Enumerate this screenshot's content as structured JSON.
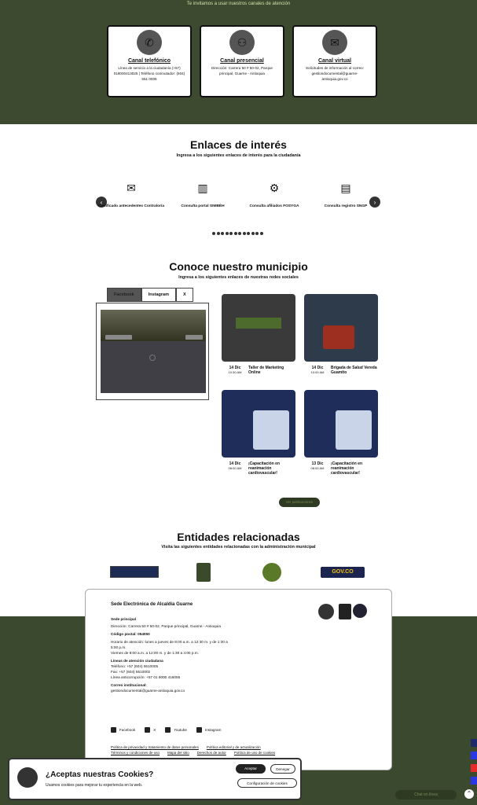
{
  "channels": {
    "intro": "Te invitamos a usar nuestros canales de atención",
    "cards": [
      {
        "icon": "phone-icon",
        "title": "Canal telefónico",
        "desc": "Línea de servicio a la ciudadanía (+57) 018000413025 | Teléfono conmutador: (604) 551 0005"
      },
      {
        "icon": "people-icon",
        "title": "Canal presencial",
        "desc": "Dirección: Carrera 50 # 50-02, Parque principal, Guarne - Antioquia"
      },
      {
        "icon": "mail-icon",
        "title": "Canal virtual",
        "desc": "Solicitudes de información al correo: gestiondocumental@guarne-antioquia.gov.co"
      }
    ]
  },
  "links": {
    "title": "Enlaces de interés",
    "subtitle": "Ingresa a los siguientes enlaces de interés para la ciudadanía",
    "items": [
      {
        "icon": "envelope-icon",
        "glyph": "✉",
        "label": "Certificado antecedentes Contraloría"
      },
      {
        "icon": "card-icon",
        "glyph": "▥",
        "label": "Consulta portal SIMBÉH"
      },
      {
        "icon": "gear-icon",
        "glyph": "⚙",
        "label": "Consulta afiliados FOSYGA"
      },
      {
        "icon": "table-icon",
        "glyph": "▤",
        "label": "Consulta registro SNGP"
      }
    ],
    "prev": "‹",
    "next": "›"
  },
  "municipio": {
    "title": "Conoce nuestro municipio",
    "subtitle": "Ingresa a los siguientes enlaces de nuestras redes sociales",
    "tabs": [
      "Facebook",
      "Instagram",
      "X"
    ],
    "posts": [
      {
        "day": "14 Dic",
        "time": "10:30 AM",
        "title": "Taller de Marketing Online"
      },
      {
        "day": "14 Dic",
        "time": "10:00 AM",
        "title": "Brigada de Salud Vereda Guamito"
      },
      {
        "day": "14 Dic",
        "time": "08:00 AM",
        "title": "¡Capacitación en reanimación cardiovascular!"
      },
      {
        "day": "13 Dic",
        "time": "08:00 AM",
        "title": "¡Capacitación en reanimación cardiovascular!"
      }
    ],
    "more": "Ver publicaciones"
  },
  "entities": {
    "title": "Entidades relacionadas",
    "subtitle": "Visita las siguientes entidades relacionadas con la administración municipal",
    "gov_label": "GOV.CO"
  },
  "footer": {
    "title": "Sede Electrónica de Alcaldía Guarne",
    "sede_label": "Sede principal",
    "address": "Dirección: Carrera 50 # 50-02, Parque principal, Guarne - Antioquia",
    "postal": "Código postal: 054050",
    "hours_label": "Horario de atención: lunes a jueves de 8:00 a.m. a 12:30 m. y de 1:30 a 5:00 p.m.",
    "hours_friday": "Viernes de 8:00 a.m. a 12:00 m. y de 1:30 a 4:00 p.m.",
    "lines_label": "Líneas de atención ciudadana",
    "phone": "Teléfono: +57 (604) 5510005",
    "fax": "Fax: +57 (604) 5510002",
    "anticorr": "Línea anticorrupción: +57 01 8000 416055",
    "email_label": "Correo institucional:",
    "email": "gestiondocumental@guarne-antioquia.gov.co",
    "social": [
      "Facebook",
      "X",
      "Youtube",
      "Instagram"
    ],
    "policy1": "Política de privacidad y tratamiento de datos personales",
    "policy2": "Política editorial y de actualización",
    "policy3": "Términos y condiciones de uso",
    "policy4": "Mapa del sitio",
    "policy5": "Derechos de autor",
    "policy6": "Política de uso de cookies"
  },
  "cookie": {
    "title": "¿Aceptas nuestras Cookies?",
    "text": "Usamos cookies para mejorar tu experiencia en la web.",
    "accept": "Aceptar",
    "deny": "Denegar",
    "config": "Configuración de cookies"
  },
  "chat": {
    "label": "Chat en línea"
  }
}
